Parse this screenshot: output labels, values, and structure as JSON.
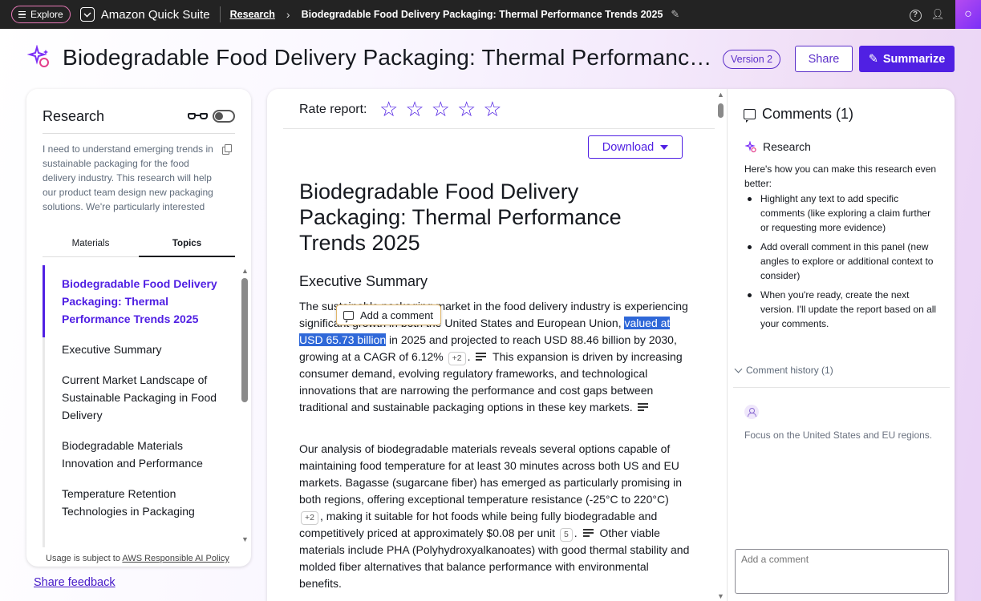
{
  "topbar": {
    "explore_label": "Explore",
    "brand": "Amazon Quick Suite",
    "breadcrumb_link": "Research",
    "breadcrumb_current": "Biodegradable Food Delivery Packaging: Thermal Performance Trends 2025"
  },
  "header": {
    "title": "Biodegradable Food Delivery Packaging: Thermal Performance Trends 2025",
    "version": "Version 2",
    "share_label": "Share",
    "summarize_label": "Summarize"
  },
  "left_panel": {
    "title": "Research",
    "prompt": "I need to understand emerging trends in sustainable packaging for the food delivery industry. This research will help our product team design new packaging solutions. We're particularly interested in...",
    "tabs": [
      "Materials",
      "Topics"
    ],
    "active_tab": "Topics",
    "toc": [
      "Biodegradable Food Delivery Packaging: Thermal Performance Trends 2025",
      "Executive Summary",
      "Current Market Landscape of Sustainable Packaging in Food Delivery",
      "Biodegradable Materials Innovation and Performance",
      "Temperature Retention Technologies in Packaging"
    ],
    "usage_prefix": "Usage is subject to",
    "usage_link": "AWS Responsible AI Policy",
    "feedback": "Share feedback"
  },
  "report": {
    "rate_label": "Rate report:",
    "download_label": "Download",
    "title": "Biodegradable Food Delivery Packaging: Thermal Performance Trends 2025",
    "section_title": "Executive Summary",
    "tooltip": "Add a comment",
    "p1": {
      "a": "The sustainable packaging market in the food delivery industry is experiencing significant growth in both the United States and European Union, ",
      "highlight": "valued at USD 65.73 billion",
      "b": " in 2025 and projected to reach USD 88.46 billion by 2030, growing at a CAGR of 6.12%",
      "cite1": "+2",
      "c": ". ",
      "d": " This expansion is driven by increasing consumer demand, evolving regulatory frameworks, and technological innovations that are narrowing the performance and cost gaps between traditional and sustainable packaging options in these key markets. "
    },
    "p2": {
      "a": "Our analysis of biodegradable materials reveals several options capable of maintaining food temperature for at least 30 minutes across both US and EU markets. Bagasse (sugarcane fiber) has emerged as particularly promising in both regions, offering exceptional temperature resistance (-25°C to 220°C)",
      "cite1": "+2",
      "b": ", making it suitable for hot foods while being fully biodegradable and competitively priced at approximately $0.08 per unit",
      "cite2": "5",
      "c": ". ",
      "d": " Other viable materials include PHA (Polyhydroxyalkanoates) with good thermal stability and molded fiber alternatives that balance performance with environmental benefits."
    }
  },
  "comments": {
    "title": "Comments (1)",
    "research_label": "Research",
    "intro": "Here's how you can make this research even better:",
    "tips": [
      "Highlight any text to add specific comments (like exploring a claim further or requesting more evidence)",
      "Add overall comment in this panel (new angles to explore or additional context to consider)",
      "When you're ready, create the next version. I'll update the report based on all your comments."
    ],
    "history_label": "Comment history (1)",
    "history_comment": "Focus on the United States and EU regions.",
    "input_placeholder": "Add a comment"
  },
  "colors": {
    "accent": "#5020e3",
    "highlight": "#2f68d8",
    "topbar": "#232323"
  }
}
